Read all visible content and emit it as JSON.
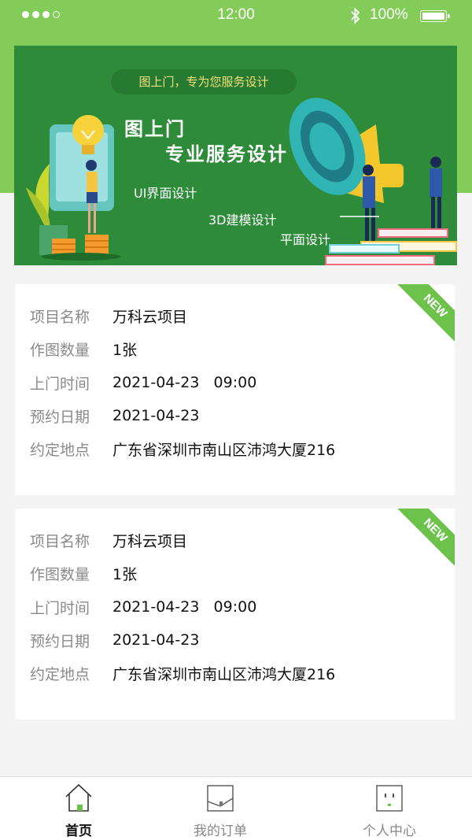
{
  "status": {
    "time": "12:00",
    "battery": "100%"
  },
  "banner": {
    "pill": "图上门，专为您服务设计",
    "title1": "图上门",
    "title2": "专业服务设计",
    "items": [
      "UI界面设计",
      "3D建模设计",
      "平面设计"
    ]
  },
  "cards": [
    {
      "badge": "NEW",
      "fields": [
        {
          "label": "项目名称",
          "value": "万科云项目"
        },
        {
          "label": "作图数量",
          "value": "1张"
        },
        {
          "label": "上门时间",
          "value": "2021-04-23   09:00"
        },
        {
          "label": "预约日期",
          "value": "2021-04-23"
        },
        {
          "label": "约定地点",
          "value": "广东省深圳市南山区沛鸿大厦216"
        }
      ]
    },
    {
      "badge": "NEW",
      "fields": [
        {
          "label": "项目名称",
          "value": "万科云项目"
        },
        {
          "label": "作图数量",
          "value": "1张"
        },
        {
          "label": "上门时间",
          "value": "2021-04-23   09:00"
        },
        {
          "label": "预约日期",
          "value": "2021-04-23"
        },
        {
          "label": "约定地点",
          "value": "广东省深圳市南山区沛鸿大厦216"
        }
      ]
    }
  ],
  "tabs": [
    {
      "label": "首页",
      "icon": "home-icon",
      "active": true
    },
    {
      "label": "我的订单",
      "icon": "order-icon",
      "active": false
    },
    {
      "label": "个人中心",
      "icon": "profile-icon",
      "active": false
    }
  ],
  "colors": {
    "brand_green": "#84cc5a",
    "banner_green": "#2e8b3a",
    "badge_green": "#6cc24a"
  }
}
